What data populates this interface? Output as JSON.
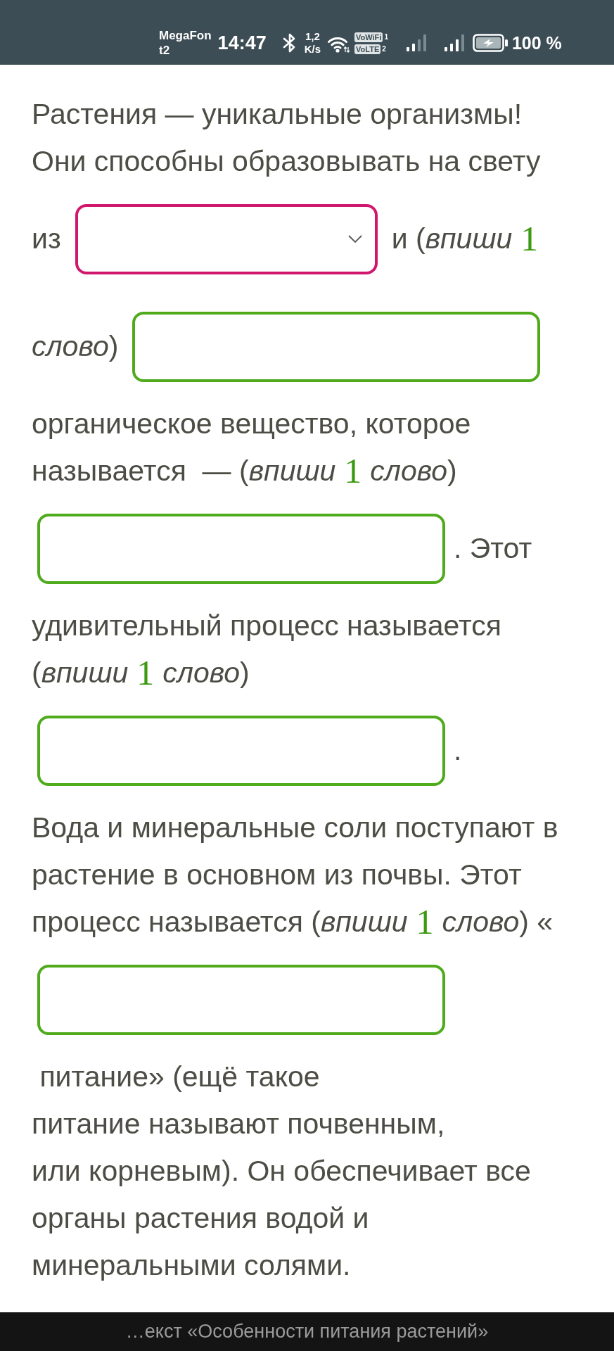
{
  "status_bar": {
    "carriers": [
      "MegaFon",
      "t2"
    ],
    "time": "14:47",
    "speed": "1,2",
    "speed_unit": "K/s",
    "badges": [
      {
        "text": "VoWiFi",
        "sim": "1"
      },
      {
        "text": "VoLTE",
        "sim": "2"
      }
    ],
    "battery": "100 %"
  },
  "exercise": {
    "lines": [
      {
        "parts": [
          {
            "kind": "text",
            "text": "Растения — уникальные организмы!"
          }
        ]
      },
      {
        "parts": [
          {
            "kind": "text",
            "text": "Они способны образовывать на свету"
          }
        ]
      },
      {
        "parts": [
          {
            "kind": "text",
            "text": "из"
          },
          {
            "kind": "select"
          },
          {
            "kind": "text",
            "text": "и (*впиши*"
          },
          {
            "kind": "count",
            "text": "1"
          }
        ]
      },
      {
        "parts": [
          {
            "kind": "text",
            "text": "*слово*)"
          },
          {
            "kind": "input"
          }
        ]
      },
      {
        "parts": [
          {
            "kind": "text",
            "text": "органическое вещество, которое"
          }
        ]
      },
      {
        "parts": [
          {
            "kind": "text",
            "text": "называется  — (*впиши*"
          },
          {
            "kind": "count",
            "text": "1"
          },
          {
            "kind": "text",
            "text": "*слово*)"
          }
        ]
      },
      {
        "parts": [
          {
            "kind": "input"
          },
          {
            "kind": "text",
            "text": ". Этот"
          }
        ]
      },
      {
        "parts": [
          {
            "kind": "text",
            "text": "удивительный процесс называется"
          }
        ]
      },
      {
        "parts": [
          {
            "kind": "text",
            "text": "(*впиши*"
          },
          {
            "kind": "count",
            "text": "1"
          },
          {
            "kind": "text",
            "text": "*слово*)"
          }
        ]
      },
      {
        "parts": [
          {
            "kind": "input"
          },
          {
            "kind": "text",
            "text": "."
          }
        ]
      },
      {
        "parts": [
          {
            "kind": "text",
            "text": "Вода и минеральные соли поступают в"
          }
        ]
      },
      {
        "parts": [
          {
            "kind": "text",
            "text": "растение в основном из почвы. Этот"
          }
        ]
      },
      {
        "parts": [
          {
            "kind": "text",
            "text": "процесс называется (*впиши*"
          },
          {
            "kind": "count",
            "text": "1"
          },
          {
            "kind": "text",
            "text": "*слово*) «"
          }
        ]
      },
      {
        "parts": [
          {
            "kind": "input"
          }
        ]
      },
      {
        "parts": [
          {
            "kind": "text",
            "text": " питание» (ещё такое"
          }
        ]
      },
      {
        "parts": [
          {
            "kind": "text",
            "text": "питание называют почвенным,"
          }
        ]
      },
      {
        "parts": [
          {
            "kind": "text",
            "text": "или корневым). Он обеспечивает все"
          }
        ]
      },
      {
        "parts": [
          {
            "kind": "text",
            "text": "органы растения водой и"
          }
        ]
      },
      {
        "parts": [
          {
            "kind": "text",
            "text": "минеральными солями."
          }
        ]
      }
    ]
  },
  "footer": {
    "title": "…екст «Особенности питания растений»"
  }
}
